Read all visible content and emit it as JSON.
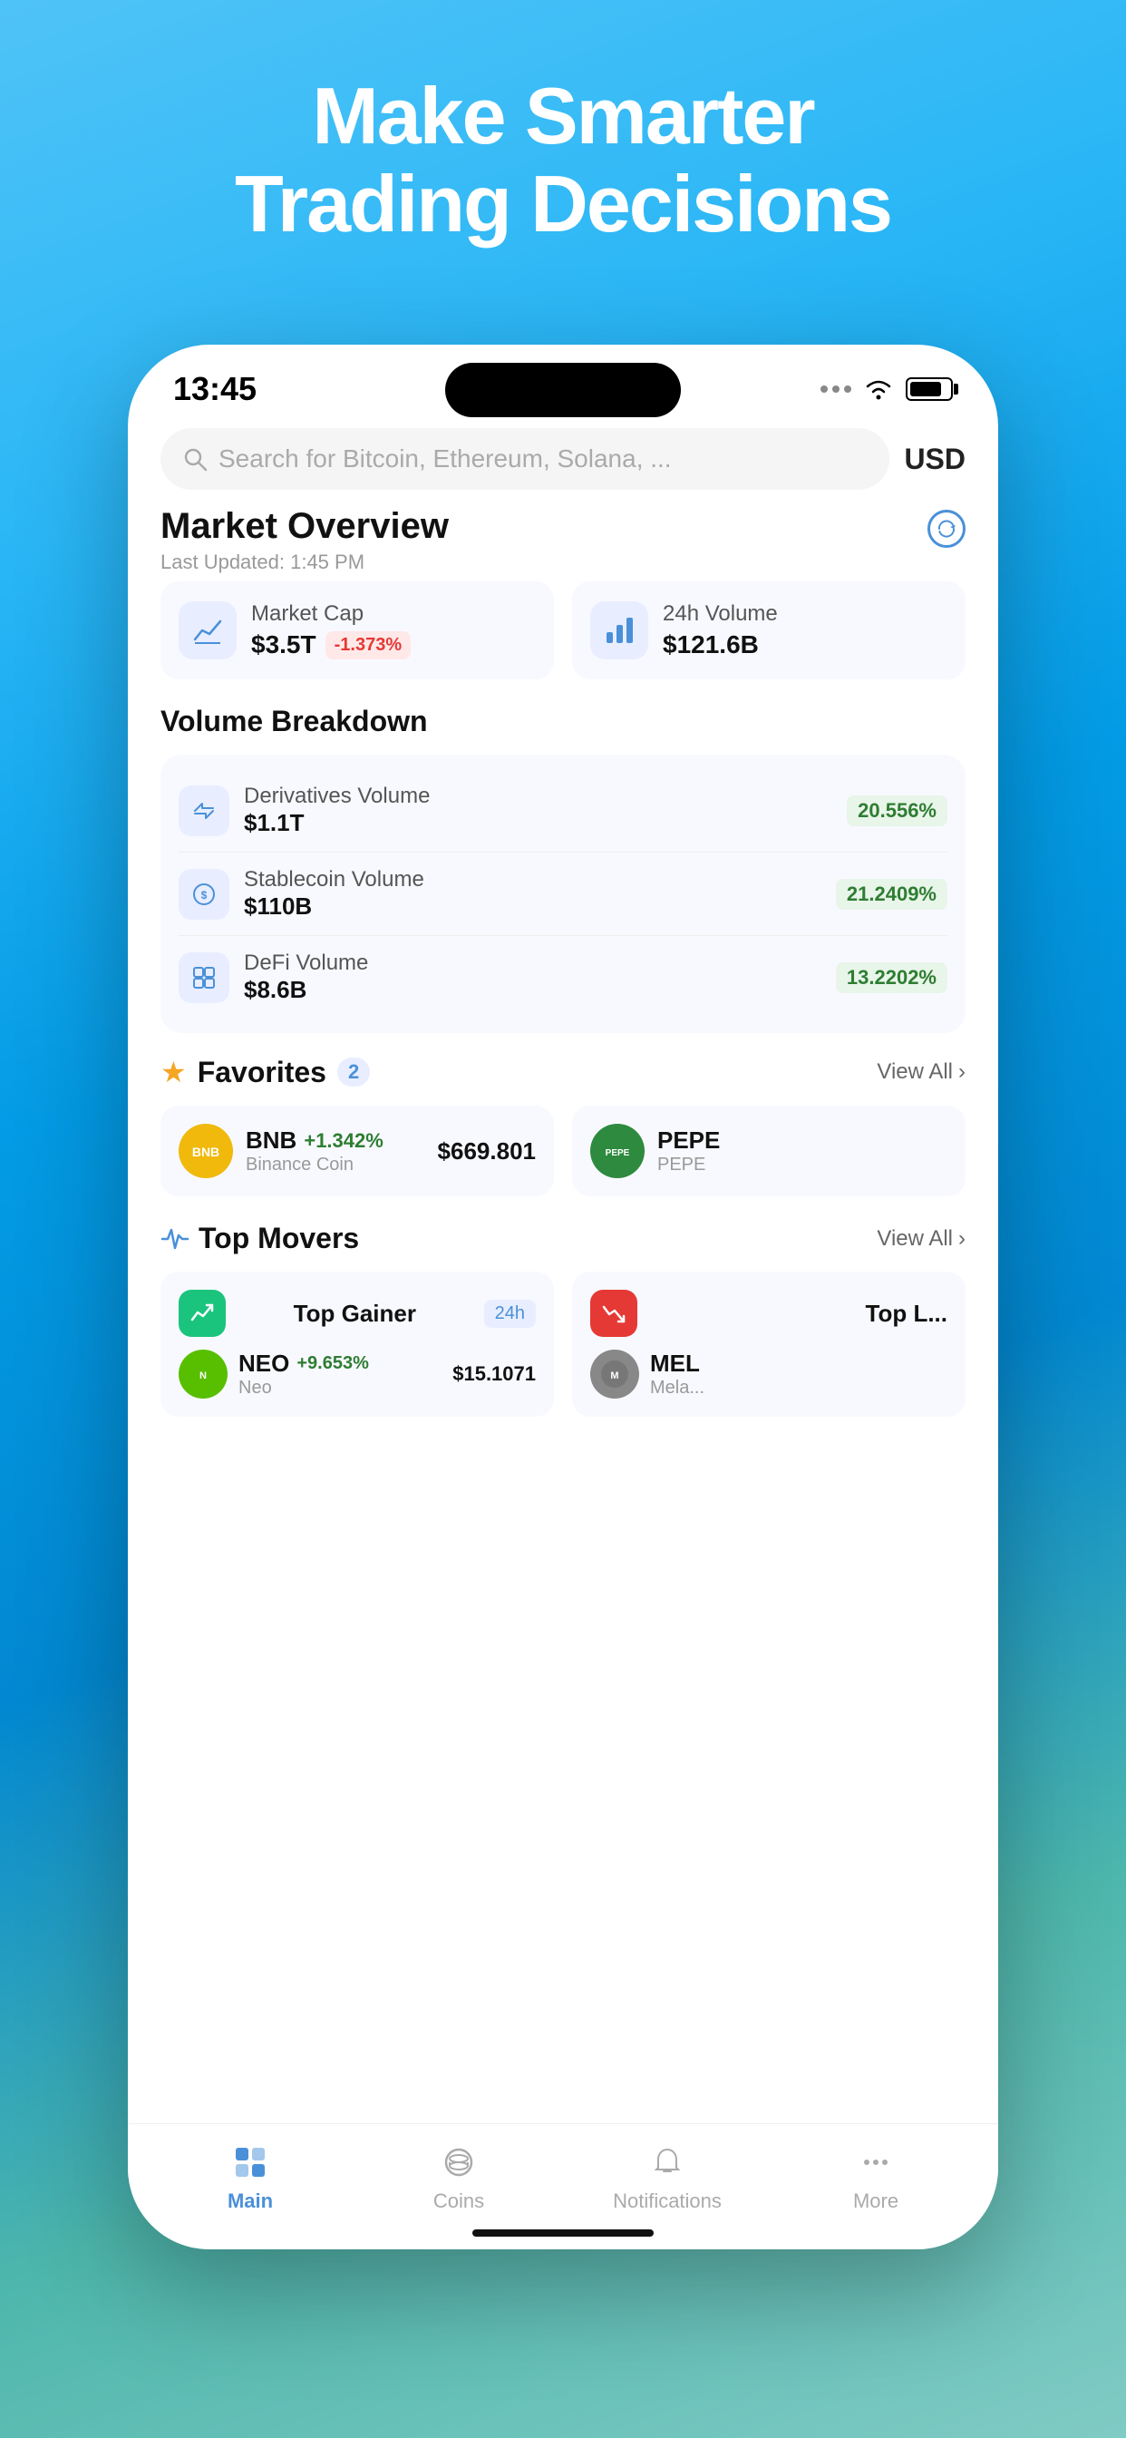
{
  "promo": {
    "line1": "Make Smarter",
    "line2": "Trading Decisions"
  },
  "statusBar": {
    "time": "13:45",
    "currency": "USD"
  },
  "search": {
    "placeholder": "Search for Bitcoin, Ethereum, Solana, ..."
  },
  "marketOverview": {
    "title": "Market Overview",
    "lastUpdated": "Last Updated: 1:45 PM",
    "marketCap": {
      "label": "Market Cap",
      "value": "$3.5T",
      "change": "-1.373%",
      "changeType": "negative"
    },
    "volume24h": {
      "label": "24h Volume",
      "value": "$121.6B"
    }
  },
  "volumeBreakdown": {
    "title": "Volume Breakdown",
    "items": [
      {
        "name": "Derivatives Volume",
        "value": "$1.1T",
        "pct": "20.556%"
      },
      {
        "name": "Stablecoin Volume",
        "value": "$110B",
        "pct": "21.2409%"
      },
      {
        "name": "DeFi Volume",
        "value": "$8.6B",
        "pct": "13.2202%"
      }
    ]
  },
  "favorites": {
    "title": "Favorites",
    "count": "2",
    "viewAll": "View All",
    "items": [
      {
        "symbol": "BNB",
        "name": "Binance Coin",
        "change": "+1.342%",
        "price": "$669.801",
        "initials": "B"
      },
      {
        "symbol": "PEPE",
        "name": "PEPE",
        "initials": "P"
      }
    ]
  },
  "topMovers": {
    "title": "Top Movers",
    "viewAll": "View All",
    "gainer": {
      "label": "Top Gainer",
      "timeframe": "24h",
      "coin": {
        "symbol": "NEO",
        "name": "Neo",
        "change": "+9.653%",
        "price": "$15.1071",
        "initials": "N"
      }
    },
    "loser": {
      "label": "Top L...",
      "coin": {
        "symbol": "MEL",
        "name": "Mela...",
        "initials": "M"
      }
    }
  },
  "bottomNav": {
    "items": [
      {
        "label": "Main",
        "active": true
      },
      {
        "label": "Coins",
        "active": false
      },
      {
        "label": "Notifications",
        "active": false
      },
      {
        "label": "More",
        "active": false
      }
    ]
  }
}
